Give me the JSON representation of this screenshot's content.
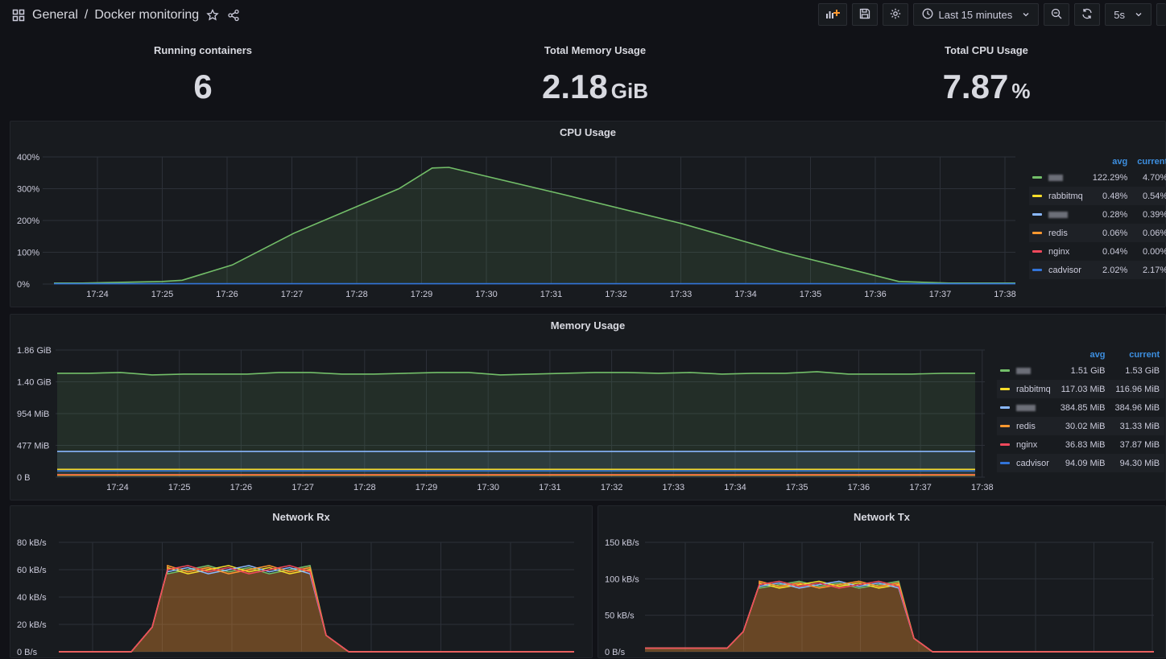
{
  "header": {
    "folder": "General",
    "separator": "/",
    "dashboard": "Docker monitoring",
    "time_range": "Last 15 minutes",
    "refresh": "5s"
  },
  "stats": [
    {
      "title": "Running containers",
      "value": "6",
      "unit": ""
    },
    {
      "title": "Total Memory Usage",
      "value": "2.18",
      "unit": "GiB"
    },
    {
      "title": "Total CPU Usage",
      "value": "7.87",
      "unit": "%"
    }
  ],
  "colors": {
    "green": "#73bf69",
    "yellow": "#fade2a",
    "cyan": "#5794f2",
    "orange": "#ff9830",
    "red": "#f2495c",
    "blue": "#1f78c1"
  },
  "cpu": {
    "title": "CPU Usage",
    "legend_headers": [
      "avg",
      "current"
    ],
    "legend": [
      {
        "name": "",
        "avg": "122.29%",
        "current": "4.70%",
        "color": "#73bf69",
        "redacted": true
      },
      {
        "name": "rabbitmq",
        "avg": "0.48%",
        "current": "0.54%",
        "color": "#fade2a"
      },
      {
        "name": "",
        "avg": "0.28%",
        "current": "0.39%",
        "color": "#8ab8ff",
        "redacted": true
      },
      {
        "name": "redis",
        "avg": "0.06%",
        "current": "0.06%",
        "color": "#ff9830"
      },
      {
        "name": "nginx",
        "avg": "0.04%",
        "current": "0.00%",
        "color": "#f2495c"
      },
      {
        "name": "cadvisor",
        "avg": "2.02%",
        "current": "2.17%",
        "color": "#3274d9"
      }
    ]
  },
  "memory": {
    "title": "Memory Usage",
    "legend_headers": [
      "avg",
      "current"
    ],
    "legend": [
      {
        "name": "",
        "avg": "1.51 GiB",
        "current": "1.53 GiB",
        "color": "#73bf69",
        "redacted": true
      },
      {
        "name": "rabbitmq",
        "avg": "117.03 MiB",
        "current": "116.96 MiB",
        "color": "#fade2a"
      },
      {
        "name": "",
        "avg": "384.85 MiB",
        "current": "384.96 MiB",
        "color": "#8ab8ff",
        "redacted": true
      },
      {
        "name": "redis",
        "avg": "30.02 MiB",
        "current": "31.33 MiB",
        "color": "#ff9830"
      },
      {
        "name": "nginx",
        "avg": "36.83 MiB",
        "current": "37.87 MiB",
        "color": "#f2495c"
      },
      {
        "name": "cadvisor",
        "avg": "94.09 MiB",
        "current": "94.30 MiB",
        "color": "#3274d9"
      }
    ]
  },
  "net_rx": {
    "title": "Network Rx"
  },
  "net_tx": {
    "title": "Network Tx"
  },
  "chart_data": [
    {
      "type": "line",
      "title": "CPU Usage",
      "x": [
        "17:24",
        "17:25",
        "17:26",
        "17:27",
        "17:28",
        "17:29",
        "17:30",
        "17:31",
        "17:32",
        "17:33",
        "17:34",
        "17:35",
        "17:36",
        "17:37",
        "17:38"
      ],
      "y_ticks": [
        "0%",
        "100%",
        "200%",
        "300%",
        "400%"
      ],
      "ylim": [
        0,
        400
      ],
      "series": [
        {
          "values_points": [
            [
              17.23,
              3
            ],
            [
              17.4,
              3
            ],
            [
              17.88,
              8
            ],
            [
              18.0,
              12
            ],
            [
              18.3,
              60
            ],
            [
              18.67,
              160
            ],
            [
              19.3,
              300
            ],
            [
              19.5,
              365
            ],
            [
              19.6,
              367
            ],
            [
              20.3,
              280
            ],
            [
              21.0,
              190
            ],
            [
              21.6,
              100
            ],
            [
              22.3,
              8
            ],
            [
              22.6,
              3
            ],
            [
              23.0,
              3
            ]
          ],
          "color": "#73bf69"
        },
        {
          "values_points": [
            [
              17.23,
              1
            ],
            [
              23.0,
              1
            ]
          ],
          "color": "#3274d9"
        }
      ]
    },
    {
      "type": "line",
      "title": "Memory Usage",
      "x": [
        "17:24",
        "17:25",
        "17:26",
        "17:27",
        "17:28",
        "17:29",
        "17:30",
        "17:31",
        "17:32",
        "17:33",
        "17:34",
        "17:35",
        "17:36",
        "17:37",
        "17:38"
      ],
      "y_ticks": [
        "0 B",
        "477 MiB",
        "954 MiB",
        "1.40 GiB",
        "1.86 GiB"
      ],
      "ylim": [
        0,
        1.86
      ],
      "series": [
        {
          "level": 1.52,
          "color": "#73bf69"
        },
        {
          "level": 0.376,
          "color": "#8ab8ff"
        },
        {
          "level": 0.114,
          "color": "#fade2a"
        },
        {
          "level": 0.092,
          "color": "#3274d9"
        },
        {
          "level": 0.037,
          "color": "#f2495c"
        },
        {
          "level": 0.03,
          "color": "#ff9830"
        }
      ]
    },
    {
      "type": "area",
      "title": "Network Rx",
      "y_ticks": [
        "0 B/s",
        "20 kB/s",
        "40 kB/s",
        "60 kB/s",
        "80 kB/s"
      ],
      "ylim": [
        0,
        80
      ]
    },
    {
      "type": "area",
      "title": "Network Tx",
      "y_ticks": [
        "0 B/s",
        "50 kB/s",
        "100 kB/s",
        "150 kB/s"
      ],
      "ylim": [
        0,
        150
      ]
    }
  ]
}
